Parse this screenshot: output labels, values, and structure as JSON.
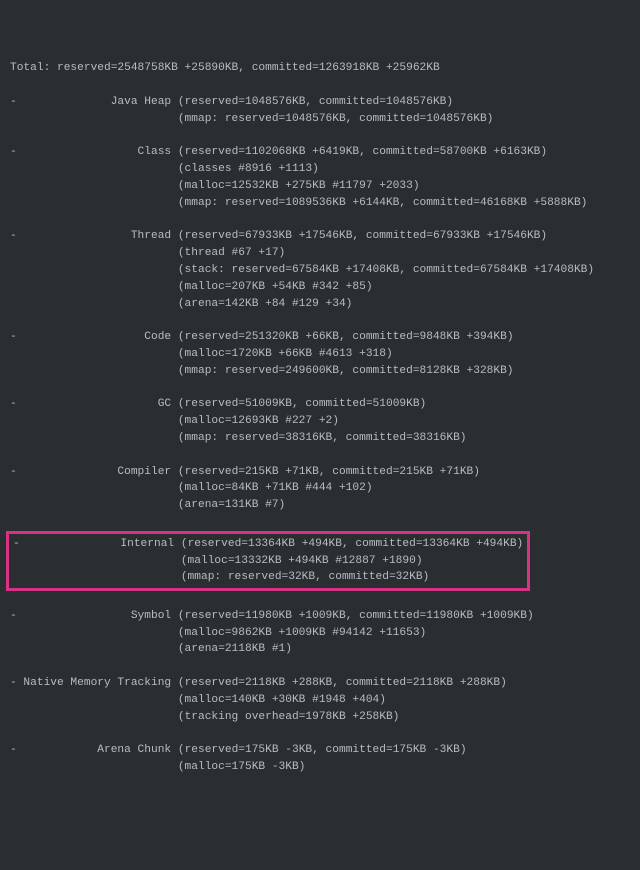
{
  "total": "Total: reserved=2548758KB +25890KB, committed=1263918KB +25962KB",
  "sections": [
    {
      "label": "-              Java Heap",
      "line1": " (reserved=1048576KB, committed=1048576KB)",
      "details": [
        "                         (mmap: reserved=1048576KB, committed=1048576KB)"
      ]
    },
    {
      "label": "-                  Class",
      "line1": " (reserved=1102068KB +6419KB, committed=58700KB +6163KB)",
      "details": [
        "                         (classes #8916 +1113)",
        "                         (malloc=12532KB +275KB #11797 +2033)",
        "                         (mmap: reserved=1089536KB +6144KB, committed=46168KB +5888KB)"
      ]
    },
    {
      "label": "-                 Thread",
      "line1": " (reserved=67933KB +17546KB, committed=67933KB +17546KB)",
      "details": [
        "                         (thread #67 +17)",
        "                         (stack: reserved=67584KB +17408KB, committed=67584KB +17408KB)",
        "                         (malloc=207KB +54KB #342 +85)",
        "                         (arena=142KB +84 #129 +34)"
      ]
    },
    {
      "label": "-                   Code",
      "line1": " (reserved=251320KB +66KB, committed=9848KB +394KB)",
      "details": [
        "                         (malloc=1720KB +66KB #4613 +318)",
        "                         (mmap: reserved=249600KB, committed=8128KB +328KB)"
      ]
    },
    {
      "label": "-                     GC",
      "line1": " (reserved=51009KB, committed=51009KB)",
      "details": [
        "                         (malloc=12693KB #227 +2)",
        "                         (mmap: reserved=38316KB, committed=38316KB)"
      ]
    },
    {
      "label": "-               Compiler",
      "line1": " (reserved=215KB +71KB, committed=215KB +71KB)",
      "details": [
        "                         (malloc=84KB +71KB #444 +102)",
        "                         (arena=131KB #7)"
      ]
    },
    {
      "highlighted": true,
      "label": "-               Internal",
      "line1": " (reserved=13364KB +494KB, committed=13364KB +494KB)",
      "details": [
        "                         (malloc=13332KB +494KB #12887 +1890)",
        "                         (mmap: reserved=32KB, committed=32KB)"
      ]
    },
    {
      "label": "-                 Symbol",
      "line1": " (reserved=11980KB +1009KB, committed=11980KB +1009KB)",
      "details": [
        "                         (malloc=9862KB +1009KB #94142 +11653)",
        "                         (arena=2118KB #1)"
      ]
    },
    {
      "label": "- Native Memory Tracking",
      "line1": " (reserved=2118KB +288KB, committed=2118KB +288KB)",
      "details": [
        "                         (malloc=140KB +30KB #1948 +404)",
        "                         (tracking overhead=1978KB +258KB)"
      ]
    },
    {
      "label": "-            Arena Chunk",
      "line1": " (reserved=175KB -3KB, committed=175KB -3KB)",
      "details": [
        "                         (malloc=175KB -3KB)"
      ]
    }
  ]
}
